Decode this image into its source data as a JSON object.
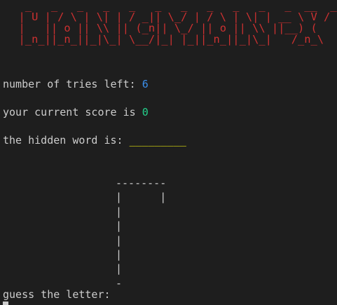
{
  "banner": {
    "art": "   _   _   _   _   _   _   _   _   _   _   _  __  __\n  | U | / \\ | \\| | / _|| \\_/ | / \\ | \\| | __ \\ V /\n  |   || o || \\\\ || (_n|| \\_/ || o || \\\\ ||__) ( \n  |_n_||_n_||_|\\_| \\__/|_| |_||_n_||_|\\_|   /_n_\\"
  },
  "status": {
    "tries_label": "number of tries left: ",
    "tries_value": "6",
    "score_label": "your current score is ",
    "score_value": "0",
    "hidden_label": "the hidden word is: ",
    "hidden_value": "_________"
  },
  "gallows": {
    "art": "--------\n|      |\n|\n|\n|\n|\n|\n-"
  },
  "prompt": {
    "text": "guess the letter:"
  },
  "colors": {
    "background": "#1e1e1e",
    "text": "#cccccc",
    "banner": "#cd3131",
    "tries": "#3b8eea",
    "score": "#23d18b",
    "hidden_word": "#e5e510"
  }
}
